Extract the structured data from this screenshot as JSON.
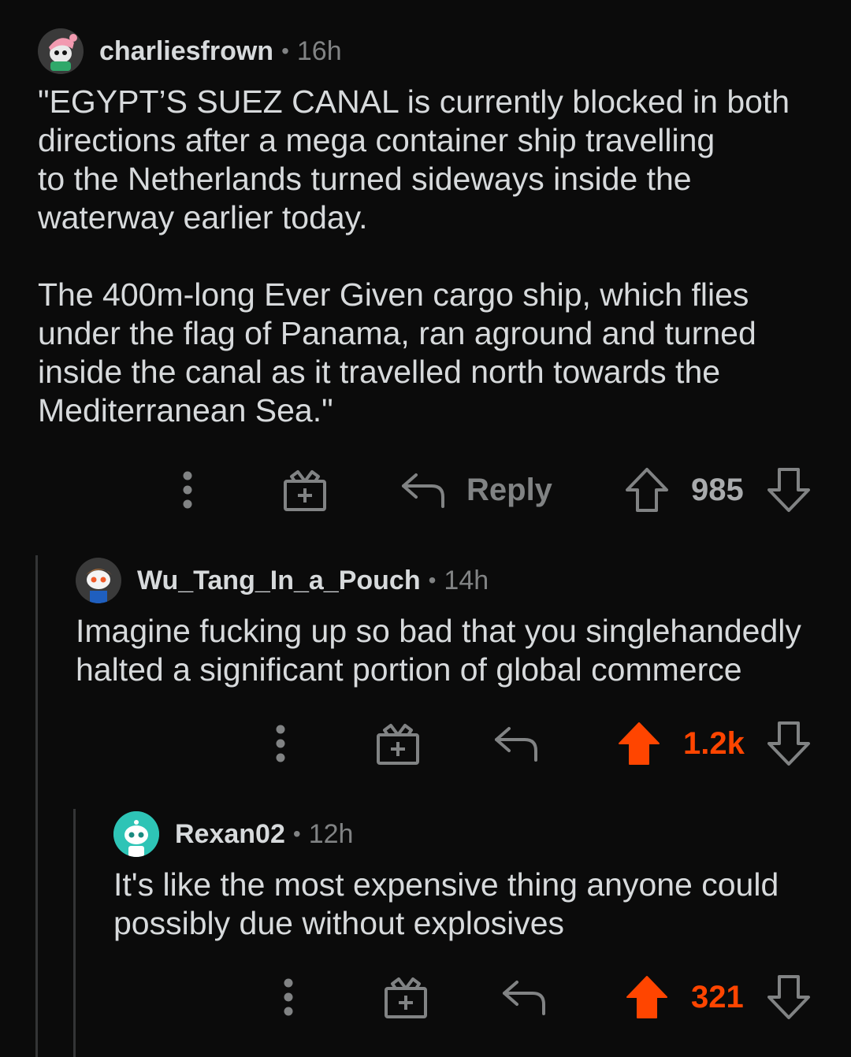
{
  "comments": [
    {
      "username": "charliesfrown",
      "separator": "•",
      "time": "16h",
      "body": "\"EGYPT’S SUEZ CANAL is currently blocked in both\ndirections after a mega container ship travelling\nto the Netherlands turned sideways inside the\nwaterway earlier today.\n\nThe 400m-long Ever Given cargo ship, which flies\nunder the flag of Panama, ran aground and turned\ninside the canal as it travelled north towards the\nMediterranean Sea.\"",
      "reply_label": "Reply",
      "score": "985",
      "upvoted": false
    },
    {
      "username": "Wu_Tang_In_a_Pouch",
      "separator": "•",
      "time": "14h",
      "body": "Imagine fucking up so bad that you singlehandedly\nhalted a significant portion of global commerce",
      "reply_label": "",
      "score": "1.2k",
      "upvoted": true
    },
    {
      "username": "Rexan02",
      "separator": "•",
      "time": "12h",
      "body": "It's like the most expensive thing anyone could\npossibly due without explosives",
      "reply_label": "",
      "score": "321",
      "upvoted": true
    }
  ],
  "icons": {
    "more": "more-vertical-icon",
    "award": "gift-award-icon",
    "reply": "reply-arrow-icon",
    "upvote": "upvote-arrow-icon",
    "downvote": "downvote-arrow-icon"
  },
  "colors": {
    "background": "#0b0b0b",
    "text": "#d7dadc",
    "muted": "#818384",
    "upvote": "#ff4500",
    "thread_line": "#343536"
  }
}
